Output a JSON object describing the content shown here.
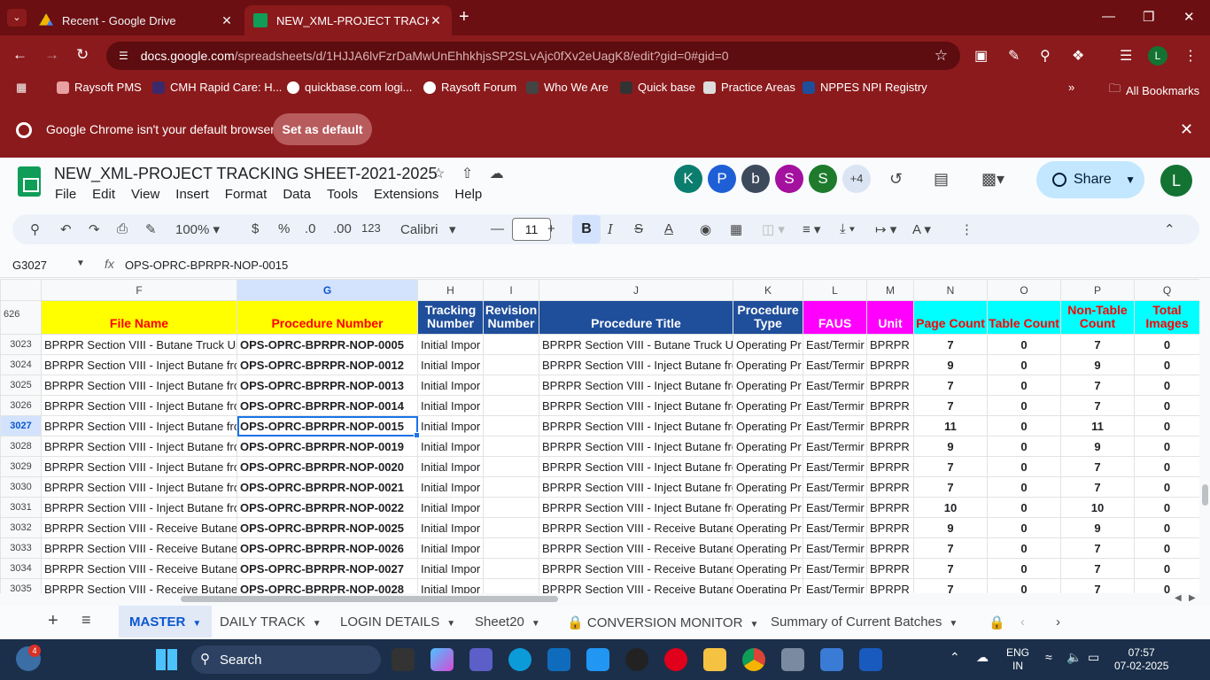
{
  "browser": {
    "tabs": [
      {
        "title": "Recent - Google Drive"
      },
      {
        "title": "NEW_XML-PROJECT TRACKING"
      }
    ],
    "url_site": "docs.google.com",
    "url_path": "/spreadsheets/d/1HJJA6lvFzrDaMwUnEhhkhjsSP2SLvAjc0fXv2eUagK8/edit?gid=0#gid=0",
    "profile_initial": "L",
    "bookmarks": [
      "Raysoft PMS",
      "CMH Rapid Care: H...",
      "quickbase.com logi...",
      "Raysoft Forum",
      "Who We Are",
      "Quick base",
      "Practice Areas",
      "NPPES NPI Registry"
    ],
    "all_bookmarks": "All Bookmarks",
    "infobar_message": "Google Chrome isn't your default browser",
    "infobar_button": "Set as default"
  },
  "sheet": {
    "title": "NEW_XML-PROJECT TRACKING SHEET-2021-2025",
    "menu": [
      "File",
      "Edit",
      "View",
      "Insert",
      "Format",
      "Data",
      "Tools",
      "Extensions",
      "Help"
    ],
    "collaborators": [
      {
        "initial": "K",
        "color": "#0b7d6e"
      },
      {
        "initial": "P",
        "color": "#1e5fd6"
      },
      {
        "initial": "b",
        "color": "#3c4a5c"
      },
      {
        "initial": "S",
        "color": "#a3119e"
      },
      {
        "initial": "S",
        "color": "#1e7b2c"
      }
    ],
    "more_collaborators": "+4",
    "share_label": "Share",
    "user_initial": "L",
    "toolbar": {
      "zoom": "100%",
      "currency": "$",
      "percent": "%",
      "dec_minus": ".0",
      "dec_plus": ".00",
      "number_format": "123",
      "font": "Calibri",
      "font_size": "11"
    },
    "cell_ref": "G3027",
    "formula": "OPS-OPRC-BPRPR-NOP-0015",
    "frozen_row_count": "626",
    "columns": [
      "F",
      "G",
      "H",
      "I",
      "J",
      "K",
      "L",
      "M",
      "N",
      "O",
      "P",
      "Q"
    ],
    "header_row": [
      {
        "text": "File Name",
        "style": "hy"
      },
      {
        "text": "Procedure Number",
        "style": "hy"
      },
      {
        "text": "Tracking Number",
        "style": "hb"
      },
      {
        "text": "Revision Number",
        "style": "hb"
      },
      {
        "text": "Procedure Title",
        "style": "hb"
      },
      {
        "text": "Procedure Type",
        "style": "hb"
      },
      {
        "text": "FAUS",
        "style": "hm"
      },
      {
        "text": "Unit",
        "style": "hm"
      },
      {
        "text": "Page Count",
        "style": "hc"
      },
      {
        "text": "Table Count",
        "style": "hc"
      },
      {
        "text": "Non-Table Count",
        "style": "hc"
      },
      {
        "text": "Total Images",
        "style": "hc"
      }
    ],
    "rows": [
      {
        "num": "3023",
        "cells": [
          "BPRPR Section VIII - Butane Truck Un",
          "OPS-OPRC-BPRPR-NOP-0005",
          "Initial Impor",
          "",
          "BPRPR Section VIII - Butane Truck Ur",
          "Operating Pr",
          "East/Termir",
          "BPRPR",
          "7",
          "0",
          "7",
          "0"
        ]
      },
      {
        "num": "3024",
        "cells": [
          "BPRPR Section VIII - Inject Butane frc",
          "OPS-OPRC-BPRPR-NOP-0012",
          "Initial Impor",
          "",
          "BPRPR Section VIII - Inject Butane fro",
          "Operating Pr",
          "East/Termir",
          "BPRPR",
          "9",
          "0",
          "9",
          "0"
        ]
      },
      {
        "num": "3025",
        "cells": [
          "BPRPR Section VIII - Inject Butane frc",
          "OPS-OPRC-BPRPR-NOP-0013",
          "Initial Impor",
          "",
          "BPRPR Section VIII - Inject Butane fro",
          "Operating Pr",
          "East/Termir",
          "BPRPR",
          "7",
          "0",
          "7",
          "0"
        ]
      },
      {
        "num": "3026",
        "cells": [
          "BPRPR Section VIII - Inject Butane frc",
          "OPS-OPRC-BPRPR-NOP-0014",
          "Initial Impor",
          "",
          "BPRPR Section VIII - Inject Butane fro",
          "Operating Pr",
          "East/Termir",
          "BPRPR",
          "7",
          "0",
          "7",
          "0"
        ]
      },
      {
        "num": "3027",
        "cells": [
          "BPRPR Section VIII - Inject Butane frc",
          "OPS-OPRC-BPRPR-NOP-0015",
          "Initial Impor",
          "",
          "BPRPR Section VIII - Inject Butane fro",
          "Operating Pr",
          "East/Termir",
          "BPRPR",
          "11",
          "0",
          "11",
          "0"
        ]
      },
      {
        "num": "3028",
        "cells": [
          "BPRPR Section VIII - Inject Butane frc",
          "OPS-OPRC-BPRPR-NOP-0019",
          "Initial Impor",
          "",
          "BPRPR Section VIII - Inject Butane fro",
          "Operating Pr",
          "East/Termir",
          "BPRPR",
          "9",
          "0",
          "9",
          "0"
        ]
      },
      {
        "num": "3029",
        "cells": [
          "BPRPR Section VIII - Inject Butane frc",
          "OPS-OPRC-BPRPR-NOP-0020",
          "Initial Impor",
          "",
          "BPRPR Section VIII - Inject Butane fro",
          "Operating Pr",
          "East/Termir",
          "BPRPR",
          "7",
          "0",
          "7",
          "0"
        ]
      },
      {
        "num": "3030",
        "cells": [
          "BPRPR Section VIII - Inject Butane frc",
          "OPS-OPRC-BPRPR-NOP-0021",
          "Initial Impor",
          "",
          "BPRPR Section VIII - Inject Butane fro",
          "Operating Pr",
          "East/Termir",
          "BPRPR",
          "7",
          "0",
          "7",
          "0"
        ]
      },
      {
        "num": "3031",
        "cells": [
          "BPRPR Section VIII - Inject Butane frc",
          "OPS-OPRC-BPRPR-NOP-0022",
          "Initial Impor",
          "",
          "BPRPR Section VIII - Inject Butane fro",
          "Operating Pr",
          "East/Termir",
          "BPRPR",
          "10",
          "0",
          "10",
          "0"
        ]
      },
      {
        "num": "3032",
        "cells": [
          "BPRPR Section VIII - Receive Butane f",
          "OPS-OPRC-BPRPR-NOP-0025",
          "Initial Impor",
          "",
          "BPRPR Section VIII - Receive Butane",
          "Operating Pr",
          "East/Termir",
          "BPRPR",
          "9",
          "0",
          "9",
          "0"
        ]
      },
      {
        "num": "3033",
        "cells": [
          "BPRPR Section VIII - Receive Butane f",
          "OPS-OPRC-BPRPR-NOP-0026",
          "Initial Impor",
          "",
          "BPRPR Section VIII - Receive Butane",
          "Operating Pr",
          "East/Termir",
          "BPRPR",
          "7",
          "0",
          "7",
          "0"
        ]
      },
      {
        "num": "3034",
        "cells": [
          "BPRPR Section VIII - Receive Butane f",
          "OPS-OPRC-BPRPR-NOP-0027",
          "Initial Impor",
          "",
          "BPRPR Section VIII - Receive Butane",
          "Operating Pr",
          "East/Termir",
          "BPRPR",
          "7",
          "0",
          "7",
          "0"
        ]
      },
      {
        "num": "3035",
        "cells": [
          "BPRPR Section VIII - Receive Butane f",
          "OPS-OPRC-BPRPR-NOP-0028",
          "Initial Impor",
          "",
          "BPRPR Section VIII - Receive Butane",
          "Operating Pr",
          "East/Termir",
          "BPRPR",
          "7",
          "0",
          "7",
          "0"
        ]
      }
    ],
    "selected_row": "3027",
    "selected_col": "G",
    "tabs": [
      "MASTER",
      "DAILY TRACK",
      "LOGIN DETAILS",
      "Sheet20",
      "CONVERSION MONITOR",
      "Summary of Current Batches"
    ]
  },
  "taskbar": {
    "search_label": "Search",
    "notification_count": "4",
    "language": "ENG",
    "region": "IN",
    "time": "07:57",
    "date": "07-02-2025"
  }
}
